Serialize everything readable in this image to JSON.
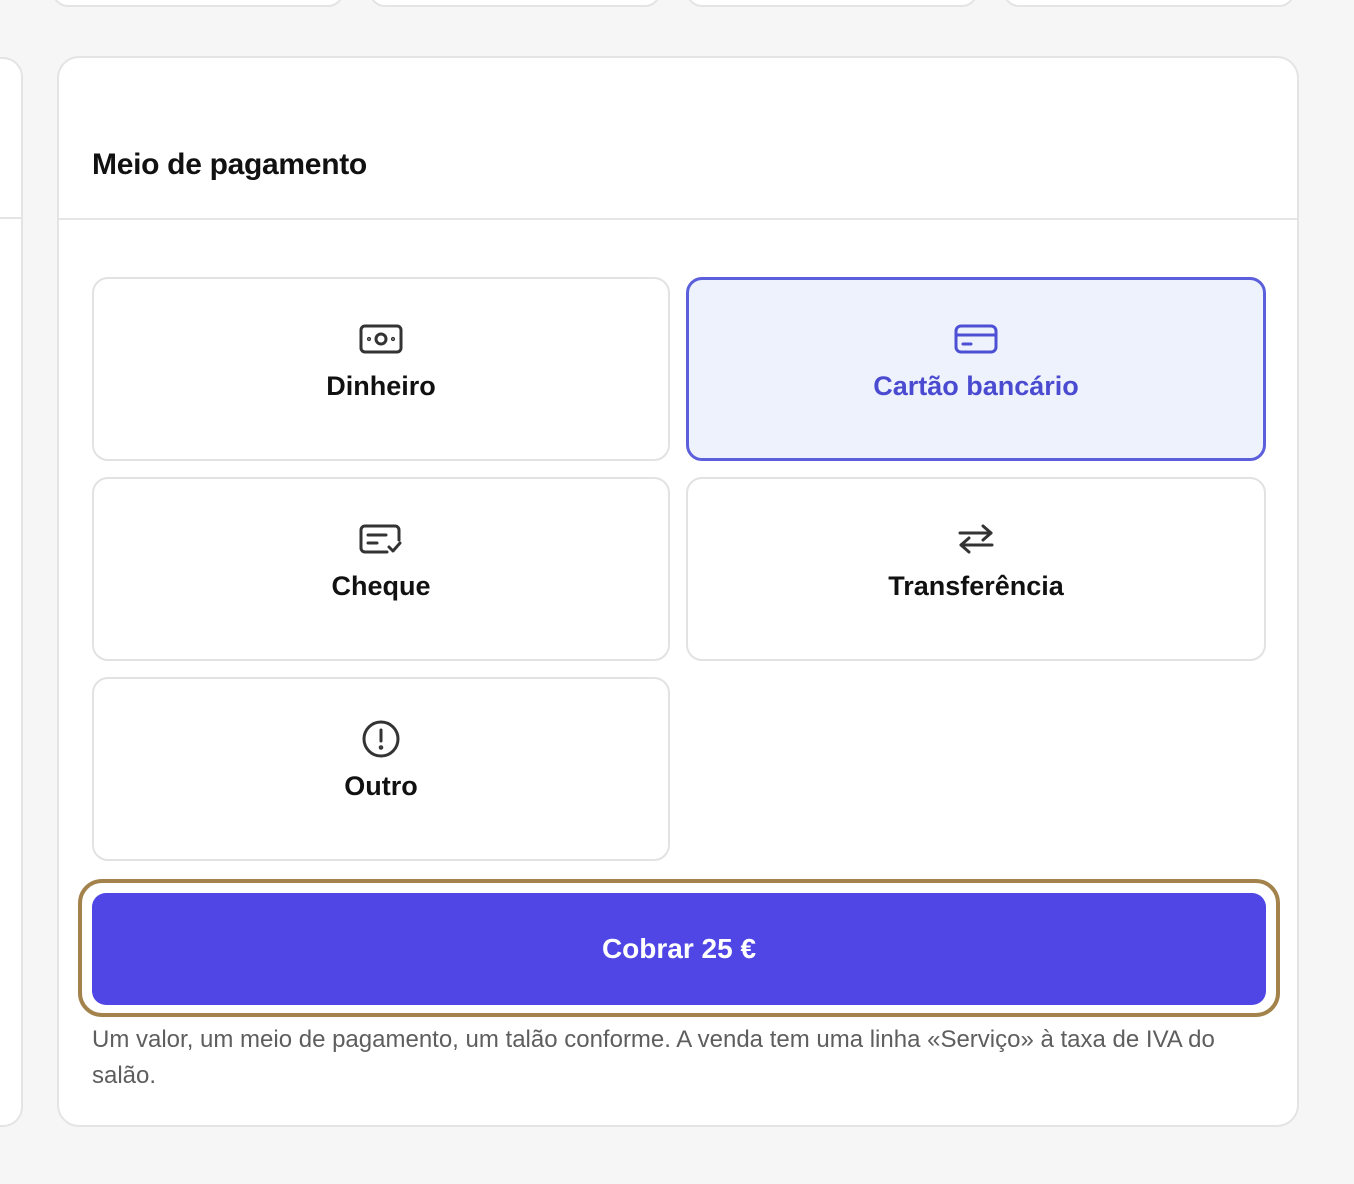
{
  "section": {
    "title": "Meio de pagamento"
  },
  "payment_options": [
    {
      "label": "Dinheiro",
      "icon": "banknote-icon",
      "selected": false
    },
    {
      "label": "Cartão bancário",
      "icon": "credit-card-icon",
      "selected": true
    },
    {
      "label": "Cheque",
      "icon": "cheque-icon",
      "selected": false
    },
    {
      "label": "Transferência",
      "icon": "transfer-arrows-icon",
      "selected": false
    },
    {
      "label": "Outro",
      "icon": "alert-circle-icon",
      "selected": false
    }
  ],
  "action": {
    "charge_label": "Cobrar 25 €"
  },
  "note": "Um valor, um meio de pagamento, um talão conforme. A venda tem uma linha «Serviço» à taxa de IVA do salão.",
  "colors": {
    "accent": "#4f46e5",
    "selected_border": "#5c5fdc",
    "selected_bg": "#eef2fd",
    "focus_ring": "#a3834b"
  }
}
